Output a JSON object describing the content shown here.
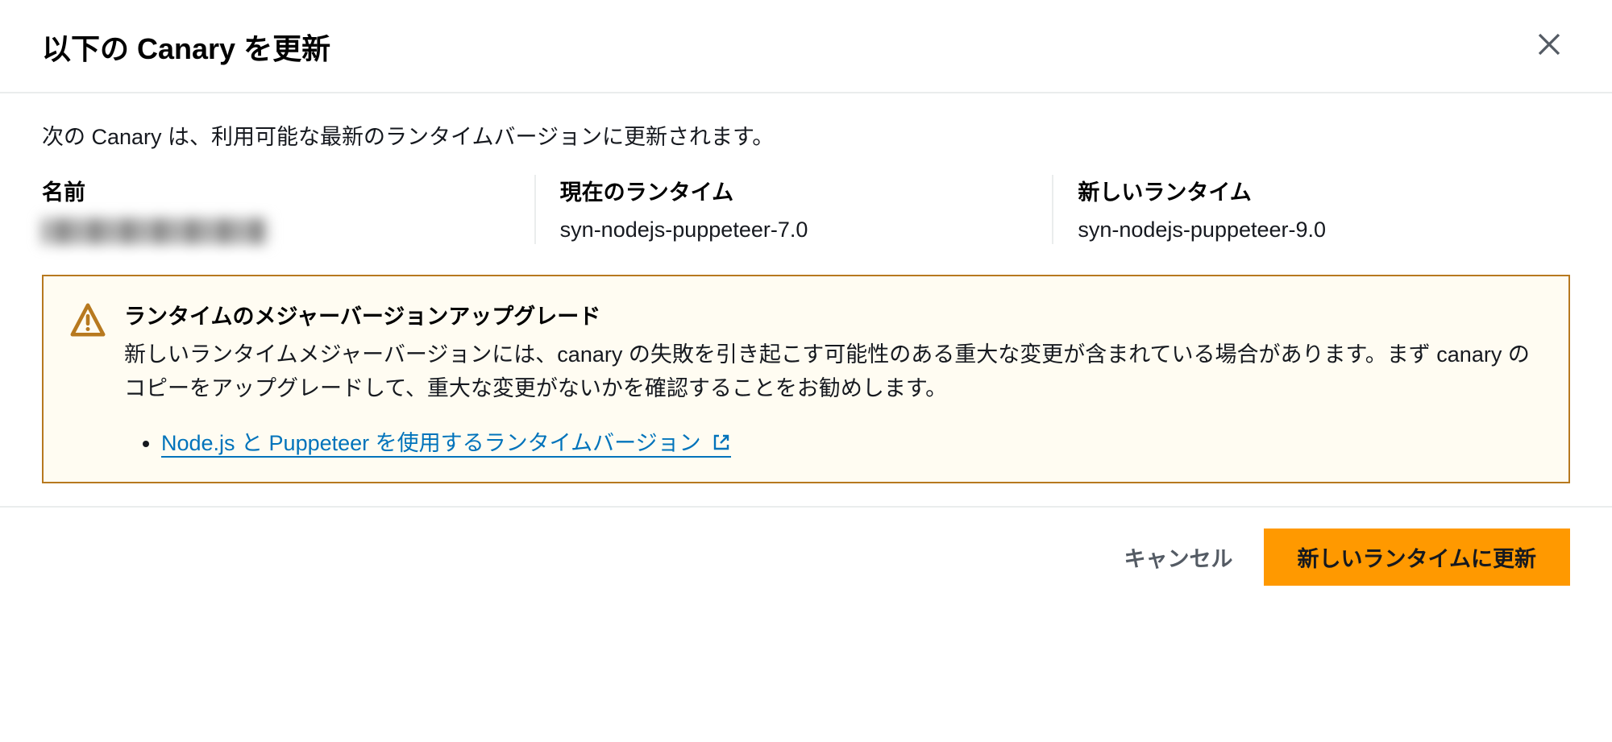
{
  "header": {
    "title": "以下の Canary を更新"
  },
  "body": {
    "intro": "次の Canary は、利用可能な最新のランタイムバージョンに更新されます。",
    "columns": {
      "name_header": "名前",
      "current_header": "現在のランタイム",
      "new_header": "新しいランタイム",
      "current_value": "syn-nodejs-puppeteer-7.0",
      "new_value": "syn-nodejs-puppeteer-9.0"
    },
    "alert": {
      "title": "ランタイムのメジャーバージョンアップグレード",
      "text": "新しいランタイムメジャーバージョンには、canary の失敗を引き起こす可能性のある重大な変更が含まれている場合があります。まず canary のコピーをアップグレードして、重大な変更がないかを確認することをお勧めします。",
      "link_text": "Node.js と Puppeteer を使用するランタイムバージョン "
    }
  },
  "footer": {
    "cancel": "キャンセル",
    "confirm": "新しいランタイムに更新"
  }
}
